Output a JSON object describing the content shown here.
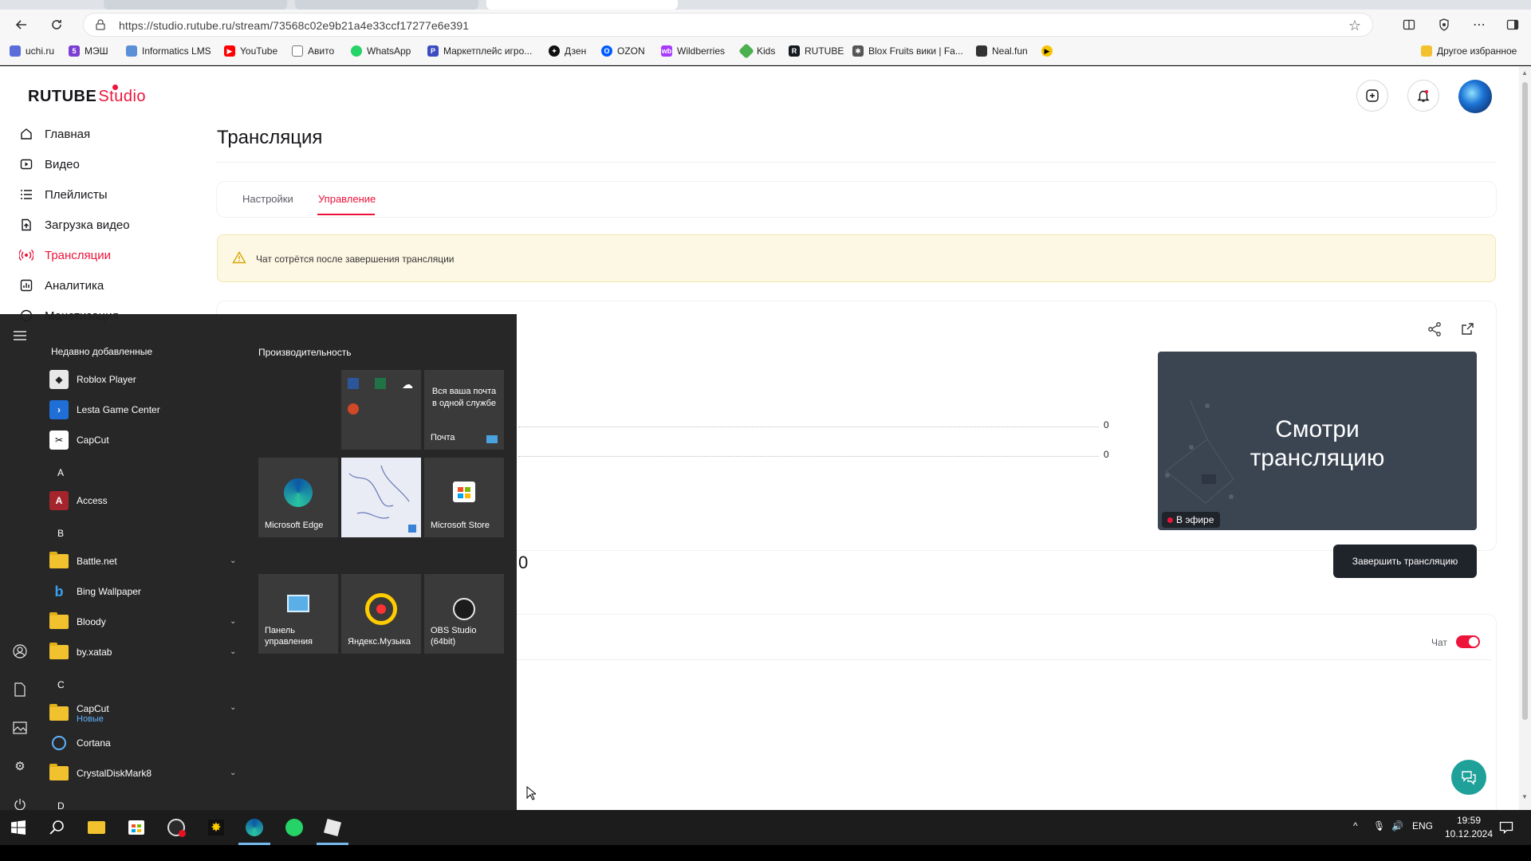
{
  "browser": {
    "url": "https://studio.rutube.ru/stream/73568c02e9b21a4e33ccf17277e6e391",
    "bookmarks": [
      {
        "label": "uchi.ru",
        "icon": "uchi-icon",
        "color": "#5b6dd8"
      },
      {
        "label": "МЭШ",
        "icon": "mesh-icon",
        "color": "#7b3fd4"
      },
      {
        "label": "Informatics LMS",
        "icon": "informatics-icon",
        "color": "#5a8fd6"
      },
      {
        "label": "YouTube",
        "icon": "youtube-icon",
        "color": "#ff0000"
      },
      {
        "label": "Авито",
        "icon": "page-icon",
        "color": "#888888"
      },
      {
        "label": "WhatsApp",
        "icon": "whatsapp-icon",
        "color": "#25d366"
      },
      {
        "label": "Маркетплейс игро...",
        "icon": "marketplace-icon",
        "color": "#3b4cc0"
      },
      {
        "label": "Дзен",
        "icon": "dzen-icon",
        "color": "#111111"
      },
      {
        "label": "OZON",
        "icon": "ozon-icon",
        "color": "#005bff"
      },
      {
        "label": "Wildberries",
        "icon": "wildberries-icon",
        "color": "#a73afd"
      },
      {
        "label": "Kids",
        "icon": "kids-icon",
        "color": "#4caf50"
      },
      {
        "label": "RUTUBE",
        "icon": "rutube-icon",
        "color": "#14191f"
      },
      {
        "label": "Blox Fruits вики | Fa...",
        "icon": "fandom-icon",
        "color": "#555555"
      },
      {
        "label": "Neal.fun",
        "icon": "nealfun-icon",
        "color": "#333333"
      }
    ],
    "other_bookmarks": "Другое избранное"
  },
  "app": {
    "logo_main": "RUTUBE",
    "logo_studio": "Studio",
    "accent": "#ed143b",
    "sidebar": [
      {
        "label": "Главная",
        "icon": "home-icon"
      },
      {
        "label": "Видео",
        "icon": "video-icon"
      },
      {
        "label": "Плейлисты",
        "icon": "playlist-icon"
      },
      {
        "label": "Загрузка видео",
        "icon": "upload-icon"
      },
      {
        "label": "Трансляции",
        "icon": "broadcast-icon",
        "active": true
      },
      {
        "label": "Аналитика",
        "icon": "analytics-icon"
      },
      {
        "label": "Монетизация",
        "icon": "monetization-icon"
      }
    ],
    "page_title": "Трансляция",
    "tabs": [
      {
        "label": "Настройки",
        "active": false
      },
      {
        "label": "Управление",
        "active": true
      }
    ],
    "warning": "Чат сотрётся после завершения трансляции",
    "stats": {
      "row1_value": "0",
      "row2_value": "0",
      "big_value": "0"
    },
    "preview": {
      "text_line1": "Смотри",
      "text_line2": "трансляцию",
      "badge": "В эфире"
    },
    "end_button": "Завершить трансляцию",
    "chat_label": "Чат",
    "chat_enabled": true
  },
  "start_menu": {
    "recent_header": "Недавно добавленные",
    "tiles_header": "Производительность",
    "recent_apps": [
      {
        "label": "Roblox Player",
        "icon": "roblox-icon"
      },
      {
        "label": "Lesta Game Center",
        "icon": "lesta-icon"
      },
      {
        "label": "CapCut",
        "icon": "capcut-icon"
      }
    ],
    "letters": [
      "A",
      "B",
      "C",
      "D"
    ],
    "apps": [
      {
        "label": "Access",
        "icon": "access-icon"
      },
      {
        "label": "Battle.net",
        "icon": "folder-icon",
        "expandable": true
      },
      {
        "label": "Bing Wallpaper",
        "icon": "bing-icon"
      },
      {
        "label": "Bloody",
        "icon": "folder-icon",
        "expandable": true
      },
      {
        "label": "by.xatab",
        "icon": "folder-icon",
        "expandable": true
      },
      {
        "label": "CapCut",
        "sub": "Новые",
        "icon": "folder-icon",
        "expandable": true
      },
      {
        "label": "Cortana",
        "icon": "cortana-icon"
      },
      {
        "label": "CrystalDiskMark8",
        "icon": "folder-icon",
        "expandable": true
      }
    ],
    "tiles": {
      "mail_text": "Вся ваша почта в одной службе",
      "mail_label": "Почта",
      "edge": "Microsoft Edge",
      "store": "Microsoft Store",
      "control_panel": "Панель управления",
      "yandex_music": "Яндекс.Музыка",
      "obs": "OBS Studio (64bit)"
    }
  },
  "taskbar": {
    "lang": "ENG",
    "time": "19:59",
    "date": "10.12.2024"
  }
}
